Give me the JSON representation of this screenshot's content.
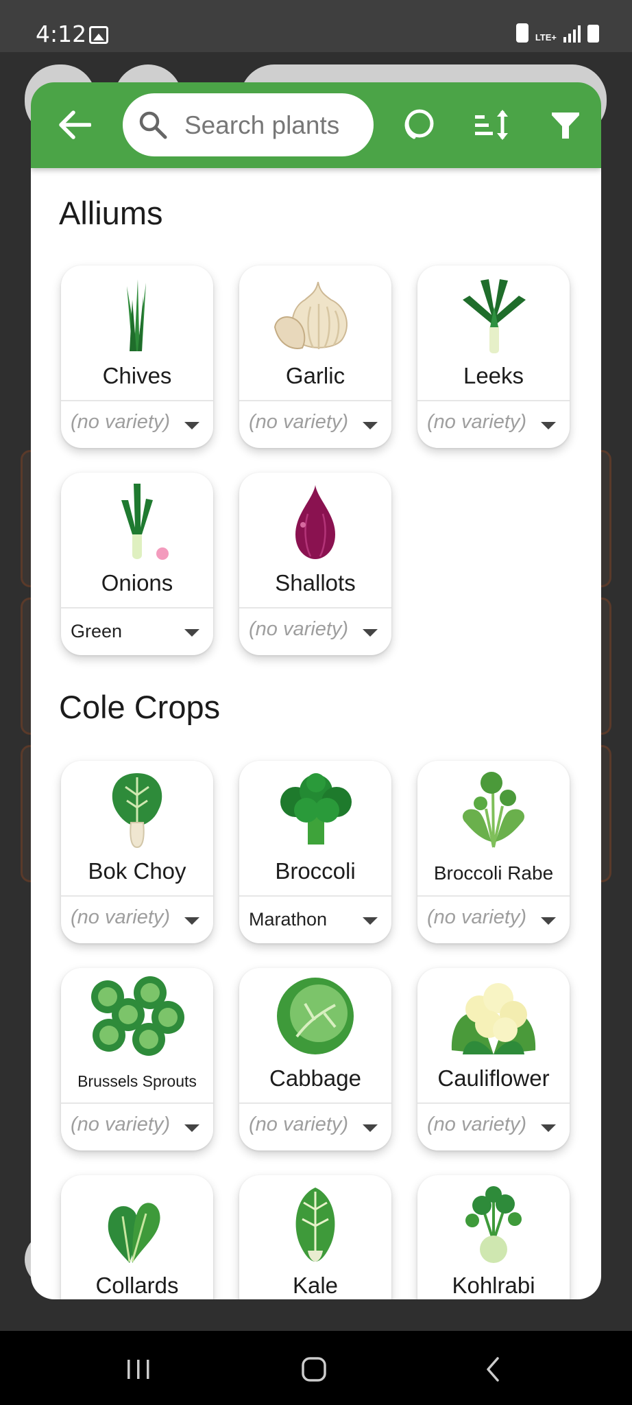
{
  "status_bar": {
    "time": "4:12",
    "network": "LTE+",
    "icons": [
      "gallery-icon",
      "sync-icon",
      "signal-icon",
      "battery-icon"
    ]
  },
  "toolbar": {
    "back_icon": "arrow-left-icon",
    "search_placeholder": "Search plants",
    "search_icon": "search-icon",
    "actions": [
      "cycle-icon",
      "sort-icon",
      "filter-icon"
    ],
    "color": "#4ba447"
  },
  "sections": [
    {
      "title": "Alliums",
      "plants": [
        {
          "name": "Chives",
          "variety": "(no variety)",
          "variety_set": false
        },
        {
          "name": "Garlic",
          "variety": "(no variety)",
          "variety_set": false
        },
        {
          "name": "Leeks",
          "variety": "(no variety)",
          "variety_set": false
        },
        {
          "name": "Onions",
          "variety": "Green",
          "variety_set": true
        },
        {
          "name": "Shallots",
          "variety": "(no variety)",
          "variety_set": false
        }
      ]
    },
    {
      "title": "Cole Crops",
      "plants": [
        {
          "name": "Bok Choy",
          "variety": "(no variety)",
          "variety_set": false
        },
        {
          "name": "Broccoli",
          "variety": "Marathon",
          "variety_set": true
        },
        {
          "name": "Broccoli Rabe",
          "variety": "(no variety)",
          "variety_set": false
        },
        {
          "name": "Brussels Sprouts",
          "variety": "(no variety)",
          "variety_set": false
        },
        {
          "name": "Cabbage",
          "variety": "(no variety)",
          "variety_set": false
        },
        {
          "name": "Cauliflower",
          "variety": "(no variety)",
          "variety_set": false
        },
        {
          "name": "Collards"
        },
        {
          "name": "Kale"
        },
        {
          "name": "Kohlrabi"
        }
      ]
    }
  ],
  "nav_bar": {
    "icons": [
      "recents-icon",
      "home-icon",
      "back-icon"
    ]
  }
}
